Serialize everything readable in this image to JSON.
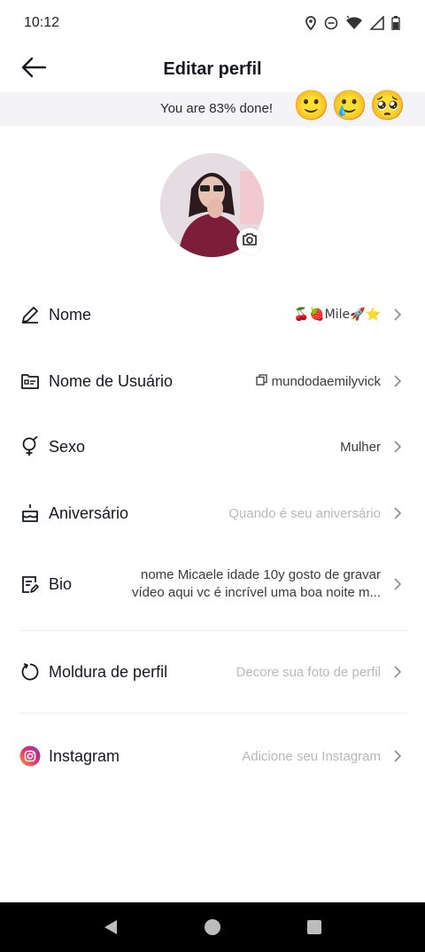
{
  "status_bar": {
    "time": "10:12"
  },
  "header": {
    "title": "Editar perfil"
  },
  "progress": {
    "text": "You are 83% done!",
    "percent": 83,
    "emojis": [
      "🙂",
      "🥲",
      "🥺"
    ]
  },
  "rows": {
    "name": {
      "label": "Nome",
      "value": "🍒🍓Mile🚀⭐"
    },
    "username": {
      "label": "Nome de Usuário",
      "value": "mundodaemilyvick"
    },
    "gender": {
      "label": "Sexo",
      "value": "Mulher"
    },
    "birthday": {
      "label": "Aniversário",
      "placeholder": "Quando é seu aniversário"
    },
    "bio": {
      "label": "Bio",
      "value_line1": "nome Micaele idade 10y gosto de gravar",
      "value_line2": "vídeo aqui vc é incrível uma boa noite m..."
    },
    "frame": {
      "label": "Moldura de perfil",
      "placeholder": "Decore sua foto de perfil"
    },
    "instagram": {
      "label": "Instagram",
      "placeholder": "Adicione seu Instagram"
    }
  },
  "colors": {
    "placeholder": "#b8b8bd",
    "text": "#161823",
    "banner_bg": "#f4f4f6",
    "nav_bg": "#000000"
  }
}
